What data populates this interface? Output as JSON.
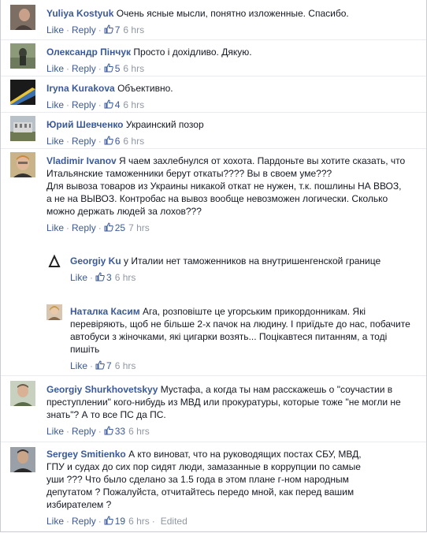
{
  "actions": {
    "like": "Like",
    "reply": "Reply",
    "dot": "·",
    "edited": "Edited"
  },
  "comments": [
    {
      "author": "Yuliya Kostyuk",
      "text": "Очень ясные мысли, понятно изложенные. Спасибо.",
      "likes": "7",
      "time": "6 hrs"
    },
    {
      "author": "Олександр Пінчук",
      "text": "Просто і дохідливо. Дякую.",
      "likes": "5",
      "time": "6 hrs"
    },
    {
      "author": "Iryna Kurakova",
      "text": "Объективно.",
      "likes": "4",
      "time": "6 hrs"
    },
    {
      "author": "Юрий Шевченко",
      "text": "Украинский позор",
      "likes": "6",
      "time": "6 hrs"
    },
    {
      "author": "Vladimir Ivanov",
      "text": "Я чаем захлебнулся от хохота. Пардоньте вы хотите сказать, что Итальянские таможенники берут откаты???? Вы в своем уме???\nДля вывоза товаров из Украины никакой откат не нужен, т.к. пошлины НА ВВОЗ, а не на ВЫВОЗ. Контробас на вывоз вообще невозможен логически. Сколько можно держать людей за лохов???",
      "likes": "25",
      "time": "7 hrs"
    },
    {
      "author": "Georgiy Ku",
      "text": "у Италии нет таможенников на внутришенгенской границе",
      "likes": "3",
      "time": "6 hrs"
    },
    {
      "author": "Наталка Касим",
      "text": "Ага, розповіште це угорським прикордонникам. Які перевіряють, щоб не більше 2-х пачок на людину. І приїдьте до нас, побачите автобуси з жіночками, які цигарки возять... Поцікавтеся питанням, а тоді пишіть",
      "likes": "7",
      "time": "6 hrs"
    },
    {
      "author": "Georgiy Shurkhovetskyy",
      "text": "Мустафа, а когда ты нам расскажешь о \"соучастии в преступлении\" кого-нибудь из МВД или прокуратуры, которые тоже \"не могли не знать\"? А то все ПС да ПС.",
      "likes": "33",
      "time": "6 hrs"
    },
    {
      "author": "Sergey Smitienko",
      "text": "А кто виноват, что на руководящих постах СБУ, МВД, ГПУ и судах до сих пор сидят люди, замазанные в коррупции по самые уши ??? Что было сделано за 1.5 года в этом плане г-ном народным депутатом ? Пожалуйста, отчитайтесь передо мной, как перед вашим избирателем ?",
      "likes": "19",
      "time": "6 hrs"
    }
  ]
}
